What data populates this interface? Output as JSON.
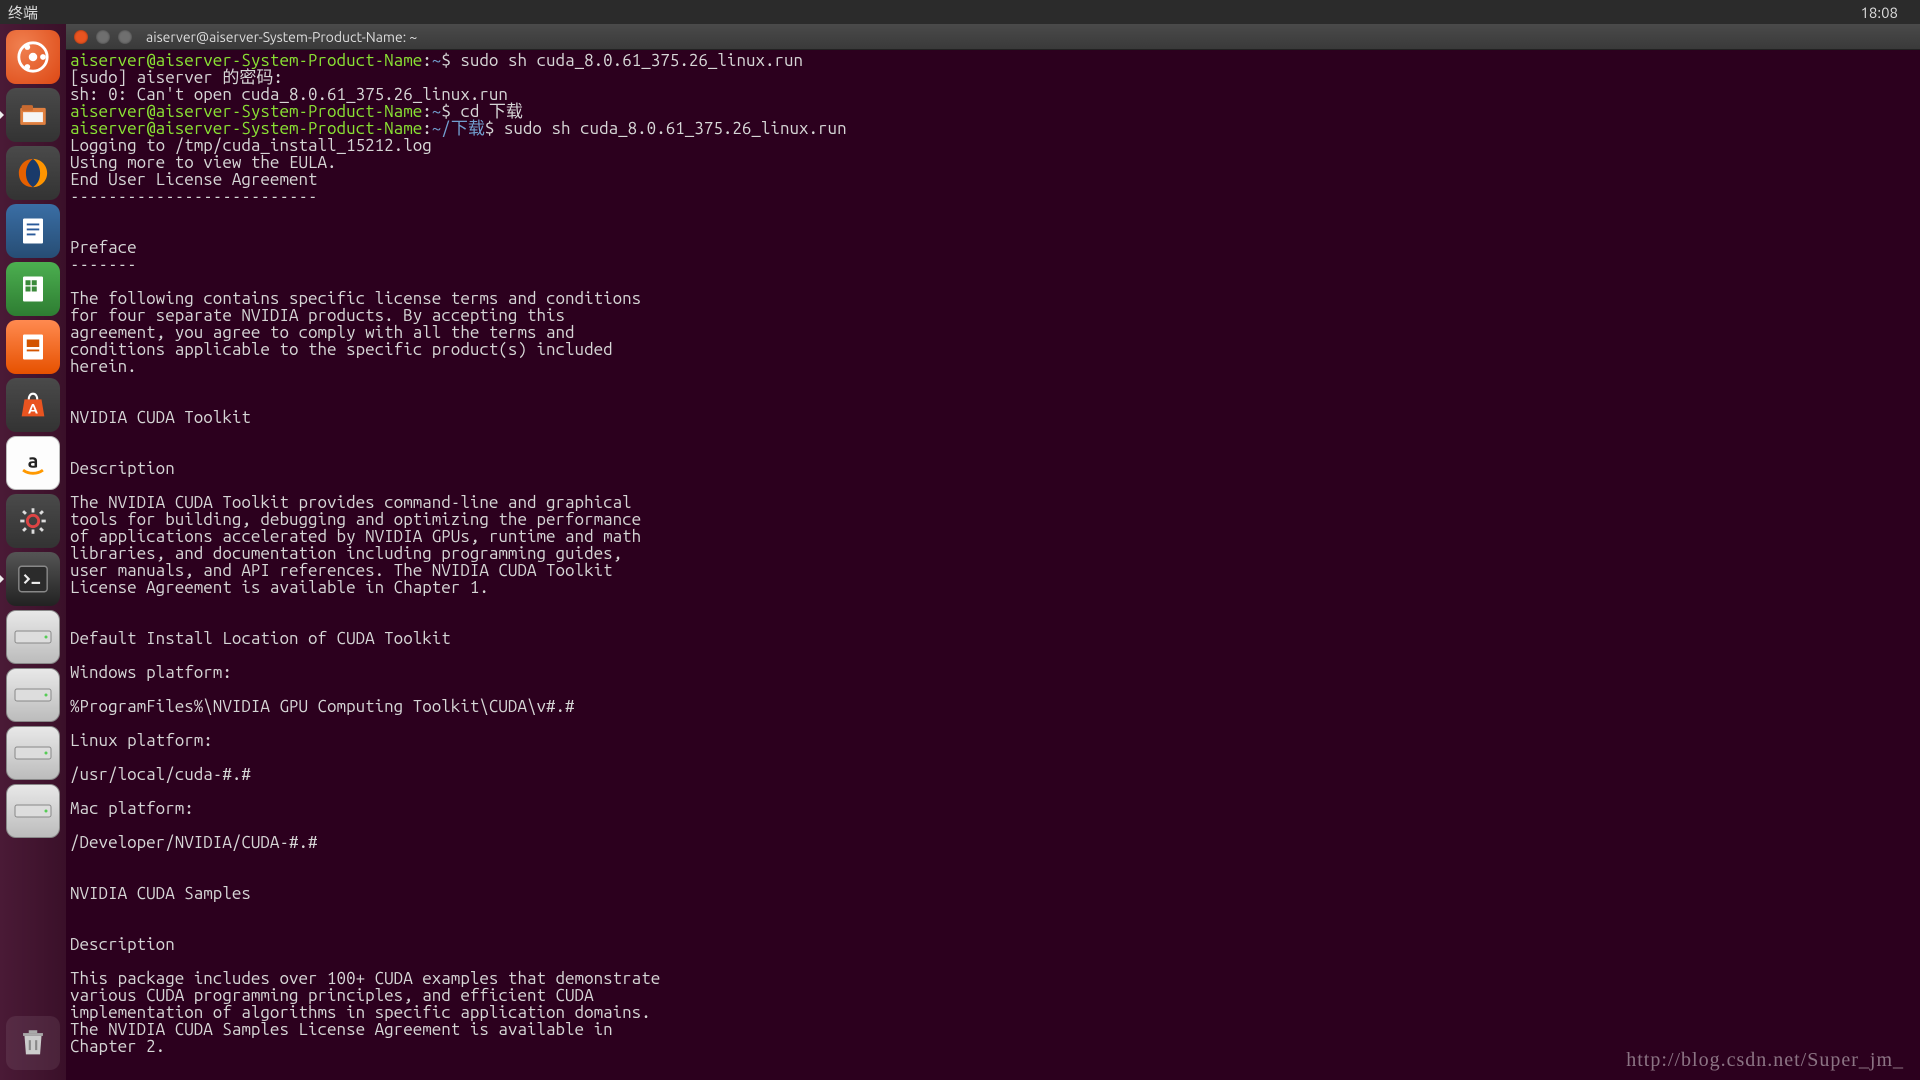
{
  "panel": {
    "title": "终端",
    "time": "18:08"
  },
  "launcher": {
    "items": [
      {
        "name": "dash-icon"
      },
      {
        "name": "files-icon",
        "active": true
      },
      {
        "name": "firefox-icon"
      },
      {
        "name": "writer-icon"
      },
      {
        "name": "calc-icon"
      },
      {
        "name": "impress-icon"
      },
      {
        "name": "software-icon"
      },
      {
        "name": "amazon-icon"
      },
      {
        "name": "settings-icon"
      },
      {
        "name": "terminal-icon",
        "active": true
      },
      {
        "name": "drive-icon-1"
      },
      {
        "name": "drive-icon-2"
      },
      {
        "name": "drive-icon-3"
      },
      {
        "name": "drive-icon-4"
      }
    ],
    "trash": {
      "name": "trash-icon"
    }
  },
  "window": {
    "title": "aiserver@aiserver-System-Product-Name: ~"
  },
  "term": {
    "prompt1_user": "aiserver@aiserver-System-Product-Name",
    "prompt1_path": "~",
    "prompt1_cmd": "sudo sh cuda_8.0.61_375.26_linux.run",
    "line_sudo": "[sudo] aiserver 的密码:",
    "line_err": "sh: 0: Can't open cuda_8.0.61_375.26_linux.run",
    "prompt2_cmd": "cd 下载",
    "prompt3_path": "~/下载",
    "prompt3_cmd": "sudo sh cuda_8.0.61_375.26_linux.run",
    "log1": "Logging to /tmp/cuda_install_15212.log",
    "log2": "Using more to view the EULA.",
    "log3": "End User License Agreement",
    "log4": "--------------------------",
    "preface_h": "Preface",
    "preface_u": "-------",
    "p1_1": "The following contains specific license terms and conditions",
    "p1_2": "for four separate NVIDIA products. By accepting this",
    "p1_3": "agreement, you agree to comply with all the terms and",
    "p1_4": "conditions applicable to the specific product(s) included",
    "p1_5": "herein.",
    "h_toolkit": "NVIDIA CUDA Toolkit",
    "h_desc": "Description",
    "d1_1": "The NVIDIA CUDA Toolkit provides command-line and graphical",
    "d1_2": "tools for building, debugging and optimizing the performance",
    "d1_3": "of applications accelerated by NVIDIA GPUs, runtime and math",
    "d1_4": "libraries, and documentation including programming guides,",
    "d1_5": "user manuals, and API references. The NVIDIA CUDA Toolkit",
    "d1_6": "License Agreement is available in Chapter 1.",
    "h_loc": "Default Install Location of CUDA Toolkit",
    "win_h": "Windows platform:",
    "win_p": "%ProgramFiles%\\NVIDIA GPU Computing Toolkit\\CUDA\\v#.#",
    "lin_h": "Linux platform:",
    "lin_p": "/usr/local/cuda-#.#",
    "mac_h": "Mac platform:",
    "mac_p": "/Developer/NVIDIA/CUDA-#.#",
    "h_samples": "NVIDIA CUDA Samples",
    "h_desc2": "Description",
    "s1_1": "This package includes over 100+ CUDA examples that demonstrate",
    "s1_2": "various CUDA programming principles, and efficient CUDA",
    "s1_3": "implementation of algorithms in specific application domains.",
    "s1_4": "The NVIDIA CUDA Samples License Agreement is available in",
    "s1_5": "Chapter 2."
  },
  "watermark": "http://blog.csdn.net/Super_jm_"
}
